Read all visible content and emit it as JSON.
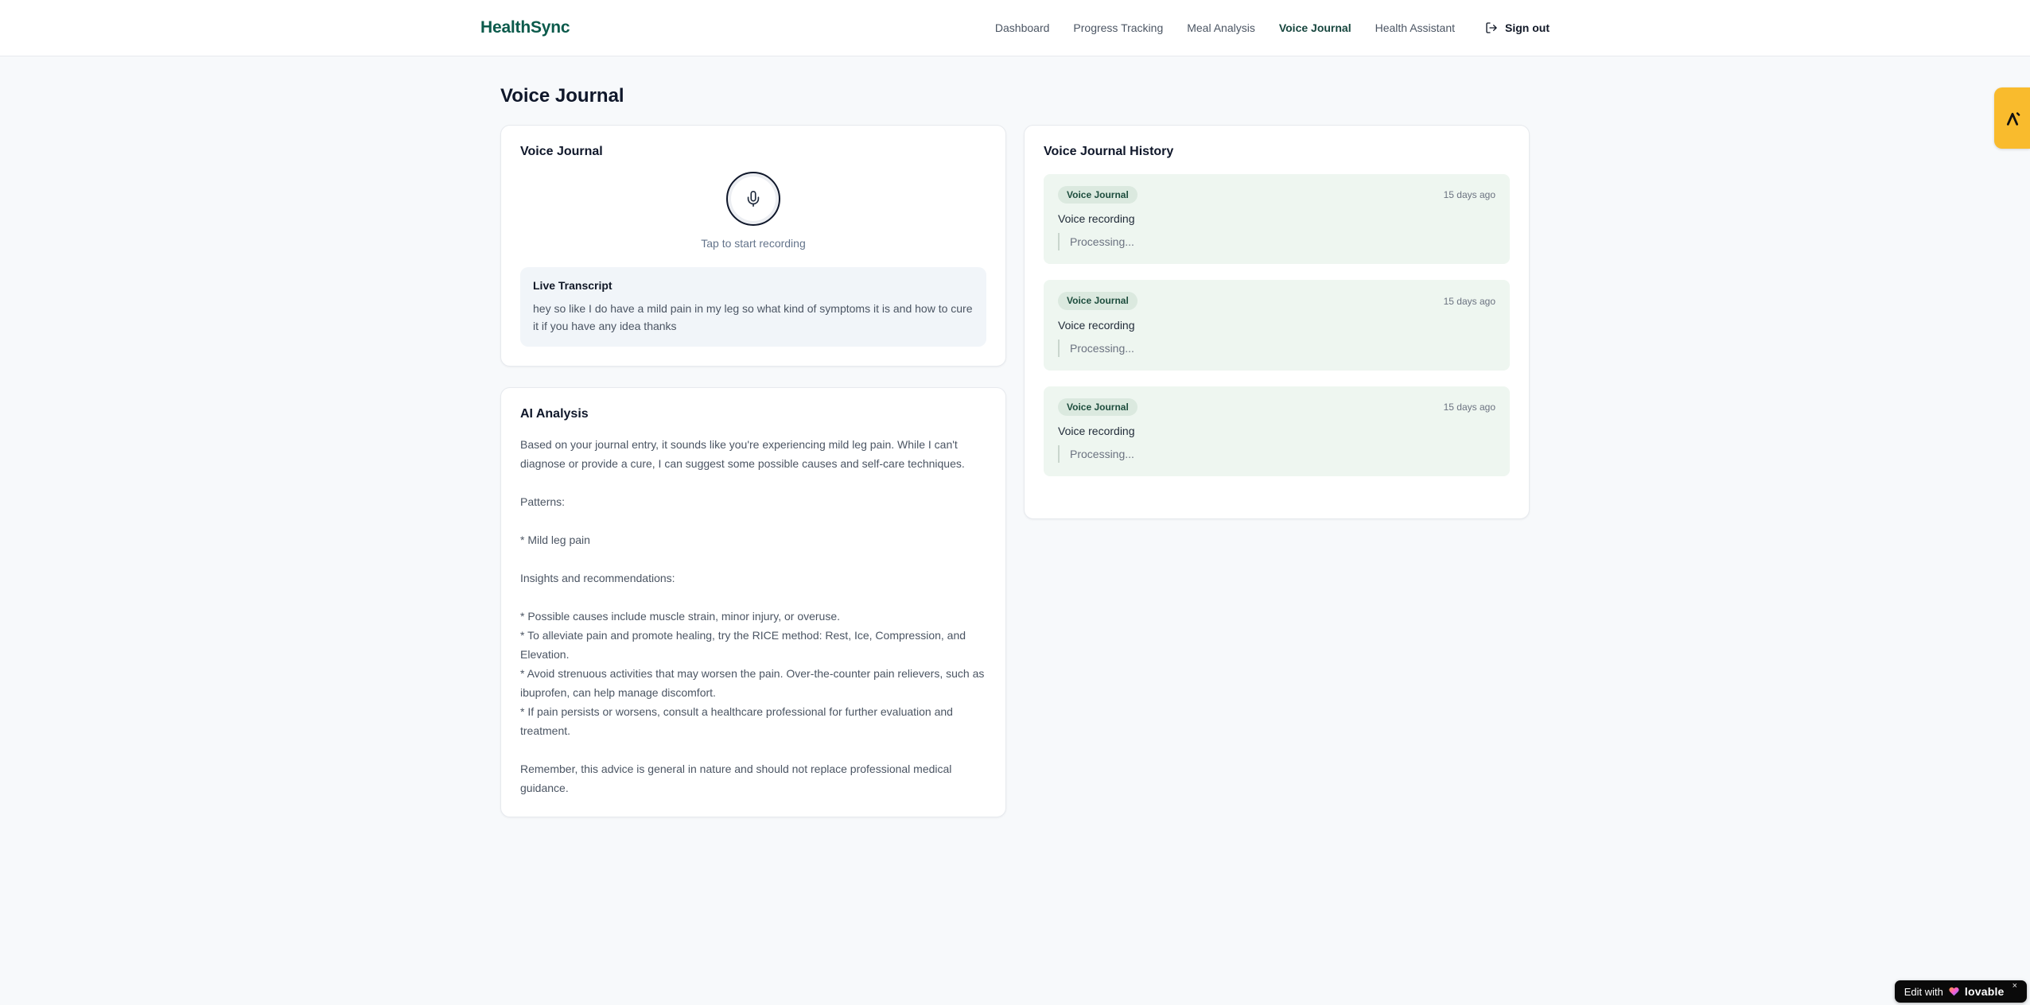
{
  "header": {
    "logo": "HealthSync",
    "nav": [
      {
        "label": "Dashboard",
        "active": false
      },
      {
        "label": "Progress Tracking",
        "active": false
      },
      {
        "label": "Meal Analysis",
        "active": false
      },
      {
        "label": "Voice Journal",
        "active": true
      },
      {
        "label": "Health Assistant",
        "active": false
      }
    ],
    "signout_label": "Sign out"
  },
  "page": {
    "title": "Voice Journal"
  },
  "recorder_card": {
    "title": "Voice Journal",
    "tap_hint": "Tap to start recording",
    "transcript_title": "Live Transcript",
    "transcript_text": "hey so like I do have a mild pain in my leg so what kind of symptoms it is and how to cure it if you have any idea thanks"
  },
  "analysis_card": {
    "title": "AI Analysis",
    "body": "Based on your journal entry, it sounds like you're experiencing mild leg pain. While I can't diagnose or provide a cure, I can suggest some possible causes and self-care techniques.\n\nPatterns:\n\n* Mild leg pain\n\nInsights and recommendations:\n\n* Possible causes include muscle strain, minor injury, or overuse.\n* To alleviate pain and promote healing, try the RICE method: Rest, Ice, Compression, and Elevation.\n* Avoid strenuous activities that may worsen the pain. Over-the-counter pain relievers, such as ibuprofen, can help manage discomfort.\n* If pain persists or worsens, consult a healthcare professional for further evaluation and treatment.\n\nRemember, this advice is general in nature and should not replace professional medical guidance."
  },
  "history_card": {
    "title": "Voice Journal History",
    "entries": [
      {
        "badge": "Voice Journal",
        "time": "15 days ago",
        "label": "Voice recording",
        "status": "Processing..."
      },
      {
        "badge": "Voice Journal",
        "time": "15 days ago",
        "label": "Voice recording",
        "status": "Processing..."
      },
      {
        "badge": "Voice Journal",
        "time": "15 days ago",
        "label": "Voice recording",
        "status": "Processing..."
      }
    ]
  },
  "widgets": {
    "edit_badge": {
      "prefix": "Edit with",
      "brand": "lovable",
      "close": "×"
    }
  },
  "colors": {
    "brand_teal": "#0b5a4b",
    "nav_active": "#17463e",
    "page_bg": "#f7f9fb",
    "transcript_bg": "#f1f5f9",
    "entry_bg": "#eef6f0",
    "badge_bg": "#dbe9df",
    "badge_text": "#1d4d3d",
    "side_tab_amber": "#f9bb2d",
    "mic_ring": "#0f172a"
  }
}
